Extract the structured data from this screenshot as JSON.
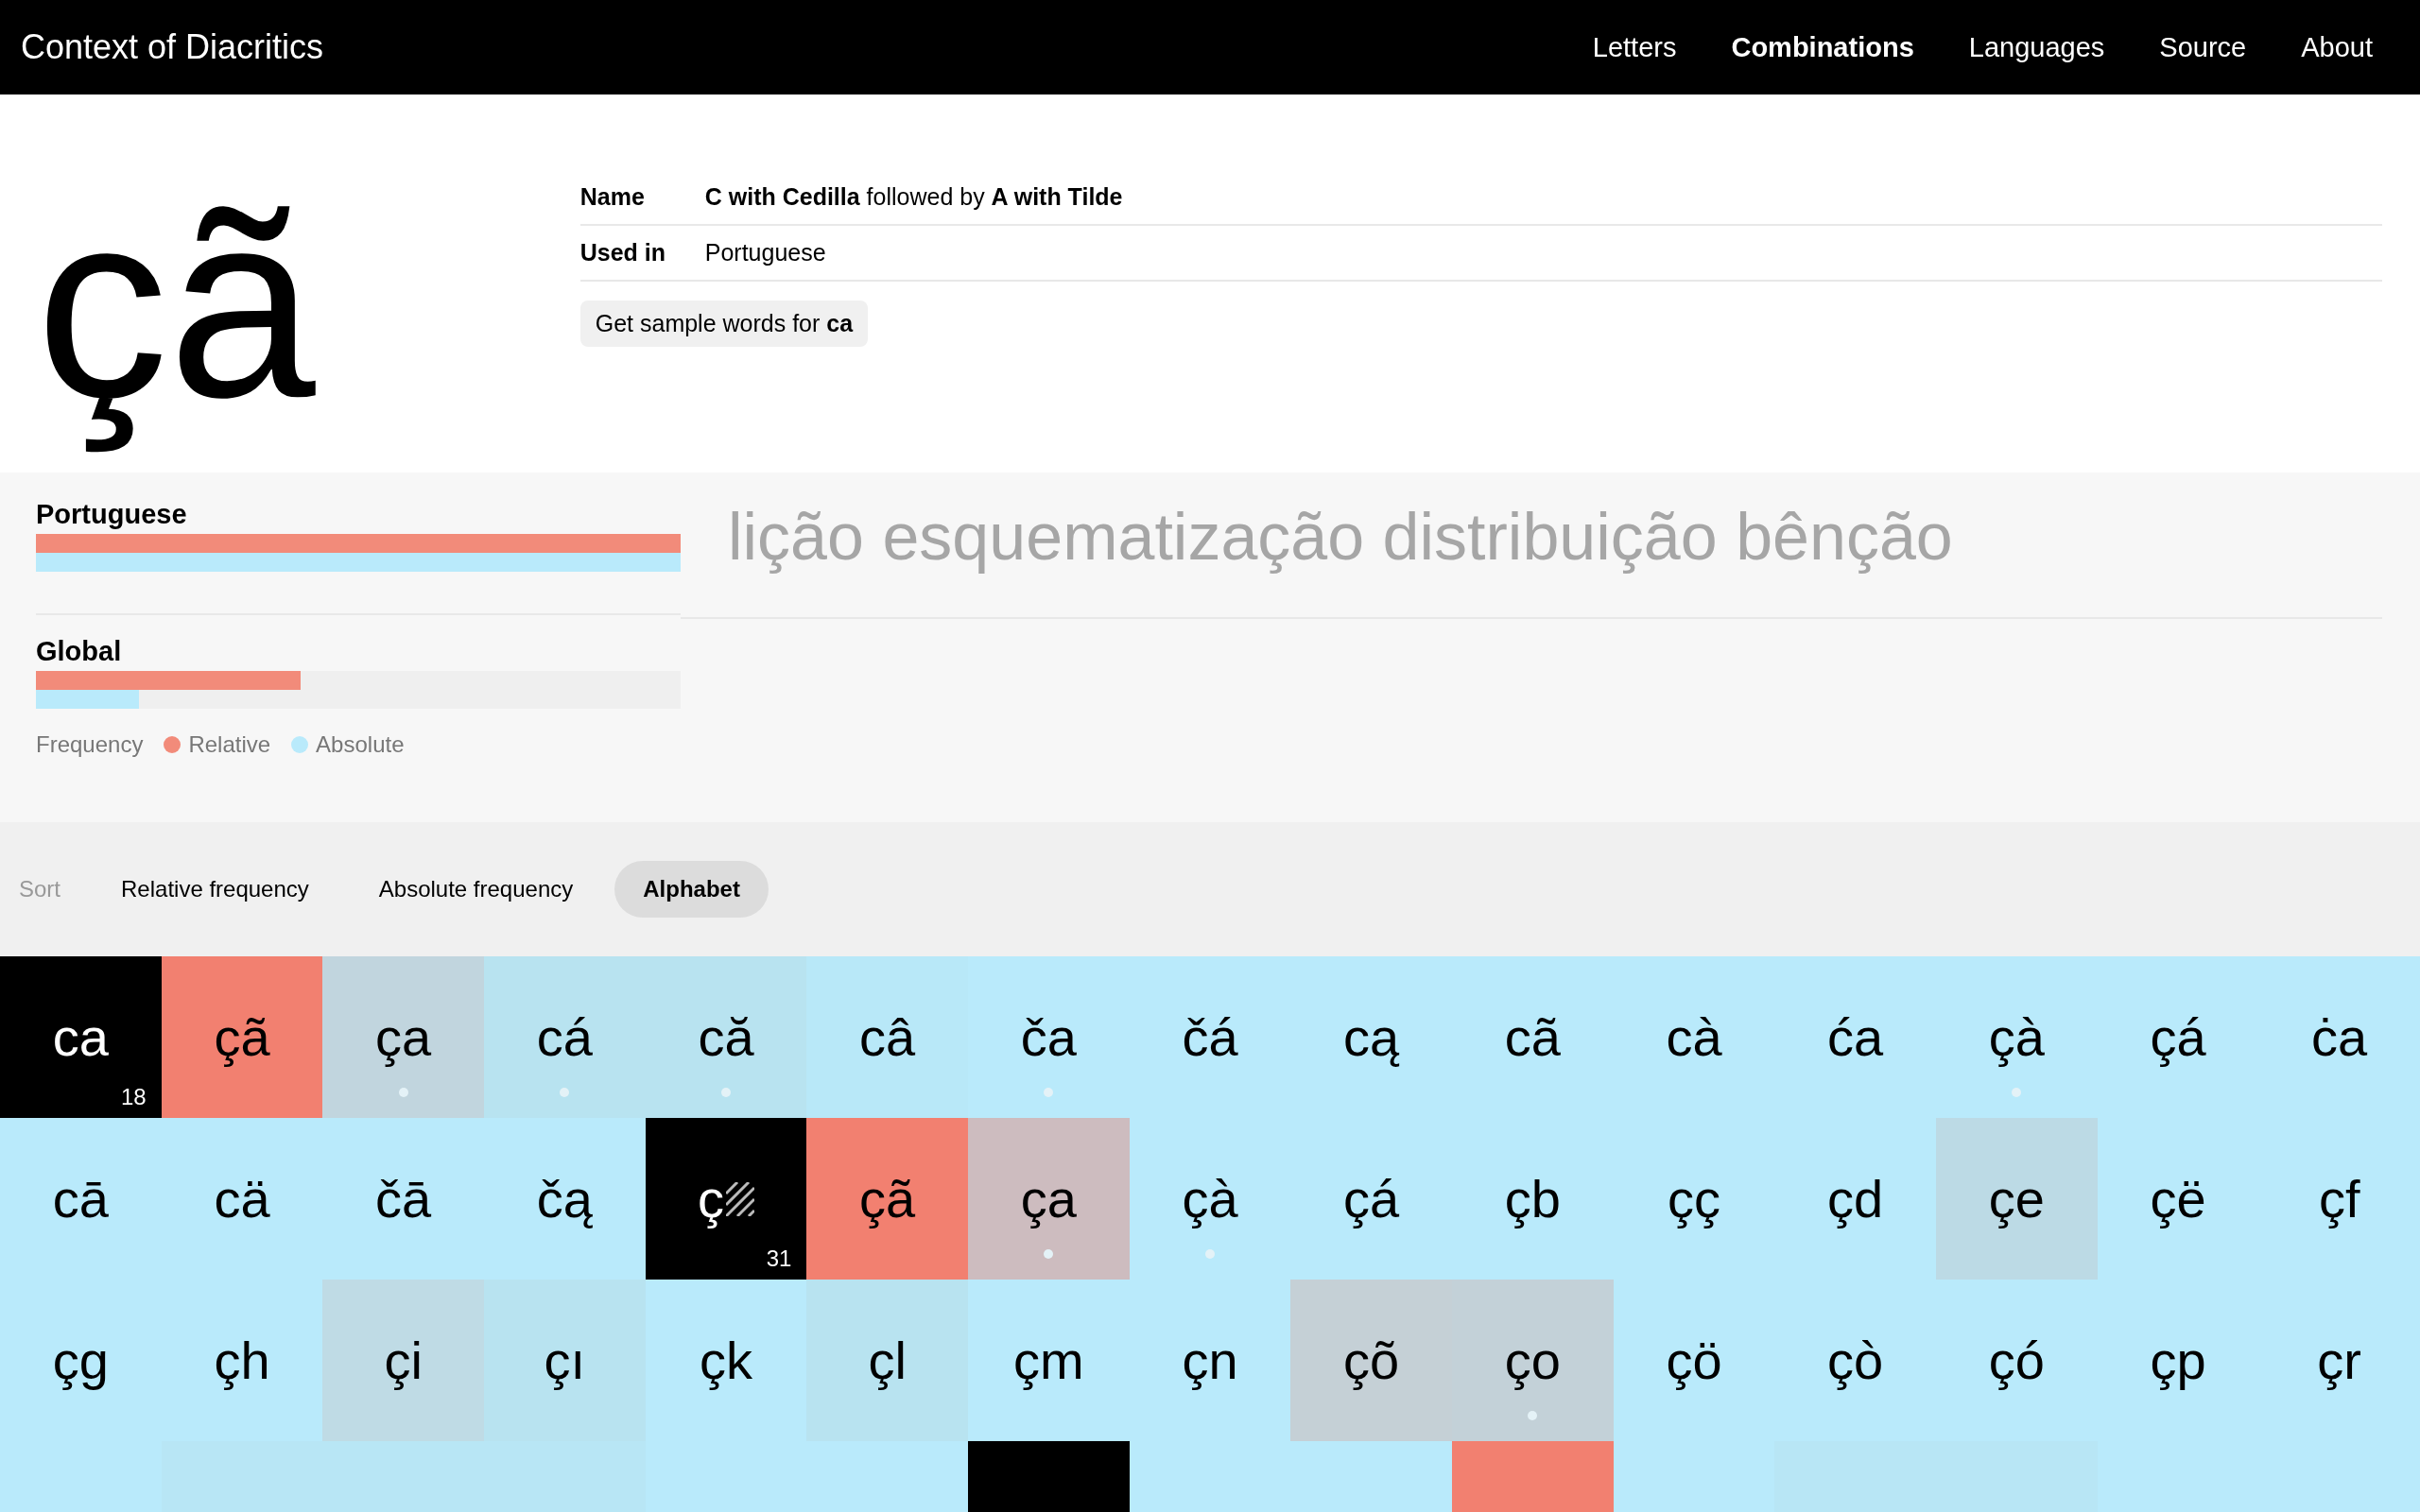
{
  "header": {
    "title": "Context of Diacritics",
    "nav": [
      {
        "label": "Letters",
        "selected": false
      },
      {
        "label": "Combinations",
        "selected": true
      },
      {
        "label": "Languages",
        "selected": false
      },
      {
        "label": "Source",
        "selected": false
      },
      {
        "label": "About",
        "selected": false
      }
    ]
  },
  "detail": {
    "glyph": "çã",
    "rows": [
      {
        "label": "Name",
        "value": "**C with Cedilla** followed by **A with Tilde**"
      },
      {
        "label": "Used in",
        "value": "Portuguese"
      }
    ],
    "sample_button": "Get sample words for **ca**"
  },
  "frequency": {
    "groups": [
      {
        "name": "Portuguese",
        "bars": [
          {
            "level": 1,
            "color": "#f28b7a"
          },
          {
            "level": 1,
            "color": "#b9eafb"
          }
        ]
      },
      {
        "name": "Global",
        "bars": [
          {
            "level": 0.41,
            "color": "#f28b7a"
          },
          {
            "level": 0.16,
            "color": "#b9eafb"
          }
        ]
      }
    ],
    "legend": {
      "label": "Frequency",
      "items": [
        {
          "label": "Relative",
          "color": "#f28b7a"
        },
        {
          "label": "Absolute",
          "color": "#b9eafb"
        }
      ]
    },
    "sample_words": "lição esquematização distribuição bênção"
  },
  "sort": {
    "label": "Sort",
    "options": [
      {
        "label": "Relative frequency",
        "selected": false
      },
      {
        "label": "Absolute frequency",
        "selected": false
      },
      {
        "label": "Alphabet",
        "selected": true
      }
    ]
  },
  "tiles": [
    {
      "kind": "current",
      "text": "ca",
      "count": "18",
      "color": "#000000",
      "dot": false
    },
    {
      "kind": "glyph",
      "text": "çã",
      "color": "#f28070",
      "dot": false
    },
    {
      "kind": "glyph",
      "text": "ça",
      "color": "#c1d5de",
      "dot": true
    },
    {
      "kind": "glyph",
      "text": "cá",
      "color": "#b8e3f0",
      "dot": true
    },
    {
      "kind": "glyph",
      "text": "că",
      "color": "#b8e3f0",
      "dot": true
    },
    {
      "kind": "glyph",
      "text": "câ",
      "color": "#b8e8f8",
      "dot": false
    },
    {
      "kind": "glyph",
      "text": "ča",
      "color": "#b9eafb",
      "dot": true
    },
    {
      "kind": "glyph",
      "text": "čá",
      "color": "#b9eafb",
      "dot": false
    },
    {
      "kind": "glyph",
      "text": "cą",
      "color": "#b9eafb",
      "dot": false
    },
    {
      "kind": "glyph",
      "text": "cã",
      "color": "#b9eafb",
      "dot": false
    },
    {
      "kind": "glyph",
      "text": "cà",
      "color": "#b9eafb",
      "dot": false
    },
    {
      "kind": "glyph",
      "text": "ća",
      "color": "#b9eafb",
      "dot": false
    },
    {
      "kind": "glyph",
      "text": "çà",
      "color": "#b9eafb",
      "dot": true
    },
    {
      "kind": "glyph",
      "text": "çá",
      "color": "#b9eafb",
      "dot": false
    },
    {
      "kind": "glyph",
      "text": "ċa",
      "color": "#b9eafb",
      "dot": false
    },
    {
      "kind": "glyph",
      "text": "cā",
      "color": "#b9eafb",
      "dot": false
    },
    {
      "kind": "glyph",
      "text": "cä",
      "color": "#b9eafb",
      "dot": false
    },
    {
      "kind": "glyph",
      "text": "čā",
      "color": "#b9eafb",
      "dot": false
    },
    {
      "kind": "glyph",
      "text": "čą",
      "color": "#b9eafb",
      "dot": false
    },
    {
      "kind": "partial",
      "text": "ç",
      "count": "31",
      "color": "#000000",
      "dot": false
    },
    {
      "kind": "glyph",
      "text": "çã",
      "color": "#f28070",
      "dot": false
    },
    {
      "kind": "glyph",
      "text": "ça",
      "color": "#cdbcbf",
      "dot": true
    },
    {
      "kind": "glyph",
      "text": "çà",
      "color": "#b9eafb",
      "dot": true
    },
    {
      "kind": "glyph",
      "text": "çá",
      "color": "#b9eafb",
      "dot": false
    },
    {
      "kind": "glyph",
      "text": "çb",
      "color": "#b9eafb",
      "dot": false
    },
    {
      "kind": "glyph",
      "text": "çç",
      "color": "#b9eafb",
      "dot": false
    },
    {
      "kind": "glyph",
      "text": "çd",
      "color": "#b9eafb",
      "dot": false
    },
    {
      "kind": "glyph",
      "text": "çe",
      "color": "#bcdae5",
      "dot": false
    },
    {
      "kind": "glyph",
      "text": "çë",
      "color": "#b9eafb",
      "dot": false
    },
    {
      "kind": "glyph",
      "text": "çf",
      "color": "#b9eafb",
      "dot": false
    },
    {
      "kind": "glyph",
      "text": "çg",
      "color": "#b9eafb",
      "dot": false
    },
    {
      "kind": "glyph",
      "text": "çh",
      "color": "#b9eafb",
      "dot": false
    },
    {
      "kind": "glyph",
      "text": "çi",
      "color": "#bfdbe5",
      "dot": false
    },
    {
      "kind": "glyph",
      "text": "çı",
      "color": "#b8e3f0",
      "dot": false
    },
    {
      "kind": "glyph",
      "text": "çk",
      "color": "#b9eafb",
      "dot": false
    },
    {
      "kind": "glyph",
      "text": "çl",
      "color": "#b8e3f0",
      "dot": false
    },
    {
      "kind": "glyph",
      "text": "çm",
      "color": "#b9eafb",
      "dot": false
    },
    {
      "kind": "glyph",
      "text": "çn",
      "color": "#b9eafb",
      "dot": false
    },
    {
      "kind": "glyph",
      "text": "çõ",
      "color": "#c5d0d6",
      "dot": false
    },
    {
      "kind": "glyph",
      "text": "ço",
      "color": "#c3d1d8",
      "dot": true
    },
    {
      "kind": "glyph",
      "text": "çö",
      "color": "#b9eafb",
      "dot": false
    },
    {
      "kind": "glyph",
      "text": "çò",
      "color": "#b9eafb",
      "dot": false
    },
    {
      "kind": "glyph",
      "text": "çó",
      "color": "#b9eafb",
      "dot": false
    },
    {
      "kind": "glyph",
      "text": "çp",
      "color": "#b9eafb",
      "dot": false
    },
    {
      "kind": "glyph",
      "text": "çr",
      "color": "#b9eafb",
      "dot": false
    },
    {
      "kind": "clipped"
    },
    {
      "kind": "clipped",
      "color": "#b8e6f5"
    },
    {
      "kind": "clipped",
      "color": "#b8e6f5"
    },
    {
      "kind": "clipped",
      "color": "#b8e6f5"
    },
    {
      "kind": "clipped"
    },
    {
      "kind": "clipped"
    },
    {
      "kind": "clipped",
      "color": "#000000"
    },
    {
      "kind": "clipped"
    },
    {
      "kind": "clipped"
    },
    {
      "kind": "clipped",
      "color": "#f28070"
    },
    {
      "kind": "clipped"
    },
    {
      "kind": "clipped",
      "color": "#b8e6f5"
    },
    {
      "kind": "clipped",
      "color": "#b8e6f5"
    }
  ]
}
